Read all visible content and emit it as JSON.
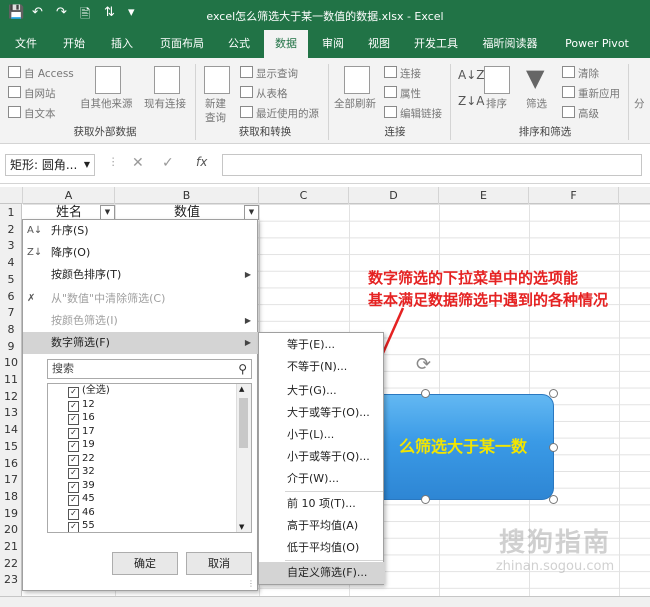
{
  "titlebar": {
    "title": "excel怎么筛选大于某一数值的数据.xlsx  -  Excel"
  },
  "tabs": [
    {
      "label": "文件"
    },
    {
      "label": "开始"
    },
    {
      "label": "插入"
    },
    {
      "label": "页面布局"
    },
    {
      "label": "公式"
    },
    {
      "label": "数据",
      "active": true
    },
    {
      "label": "审阅"
    },
    {
      "label": "视图"
    },
    {
      "label": "开发工具"
    },
    {
      "label": "福昕阅读器"
    },
    {
      "label": "Power Pivot"
    }
  ],
  "ribbon": {
    "from_access": "自 Access",
    "from_web": "自网站",
    "from_text": "自文本",
    "from_other": "自其他来源",
    "existing_conn": "现有连接",
    "group_external": "获取外部数据",
    "new_query": "新建",
    "new_query2": "查询",
    "show_queries": "显示查询",
    "from_table": "从表格",
    "recent_sources": "最近使用的源",
    "group_transform": "获取和转换",
    "refresh_all": "全部刷新",
    "connections": "连接",
    "properties": "属性",
    "edit_links": "编辑链接",
    "group_connections": "连接",
    "sort": "排序",
    "filter": "筛选",
    "clear": "清除",
    "reapply": "重新应用",
    "advanced": "高级",
    "group_sort_filter": "排序和筛选",
    "more": "分"
  },
  "formula_bar": {
    "name_box": "矩形: 圆角...",
    "fx": "fx"
  },
  "columns": [
    "A",
    "B",
    "C",
    "D",
    "E",
    "F"
  ],
  "rows": [
    "1",
    "2",
    "3",
    "4",
    "5",
    "6",
    "7",
    "8",
    "9",
    "10",
    "11",
    "12",
    "13",
    "14",
    "15",
    "16",
    "17",
    "18",
    "19",
    "20",
    "21",
    "22",
    "23"
  ],
  "cells": {
    "A1": "姓名",
    "B1": "数值"
  },
  "filter_menu": {
    "sort_asc": "升序(S)",
    "sort_desc": "降序(O)",
    "sort_by_color": "按颜色排序(T)",
    "clear_filter": "从\"数值\"中清除筛选(C)",
    "filter_by_color": "按颜色筛选(I)",
    "number_filters": "数字筛选(F)",
    "search_placeholder": "搜索",
    "items": [
      "(全选)",
      "12",
      "16",
      "17",
      "19",
      "22",
      "32",
      "39",
      "45",
      "46",
      "55"
    ],
    "ok": "确定",
    "cancel": "取消"
  },
  "number_filters_submenu": [
    "等于(E)...",
    "不等于(N)...",
    "大于(G)...",
    "大于或等于(O)...",
    "小于(L)...",
    "小于或等于(Q)...",
    "介于(W)...",
    "前 10 项(T)...",
    "高于平均值(A)",
    "低于平均值(O)",
    "自定义筛选(F)..."
  ],
  "annotation": {
    "line1": "数字筛选的下拉菜单中的选项能",
    "line2": "基本满足数据筛选中遇到的各种情况"
  },
  "shape_text": "么筛选大于某一数",
  "watermark": {
    "cn": "搜狗指南",
    "en": "zhinan.sogou.com"
  },
  "colors": {
    "excel_green": "#217346",
    "annotation_red": "#e52222",
    "shape_blue": "#3a9ae6",
    "shape_text": "#f2e500"
  }
}
